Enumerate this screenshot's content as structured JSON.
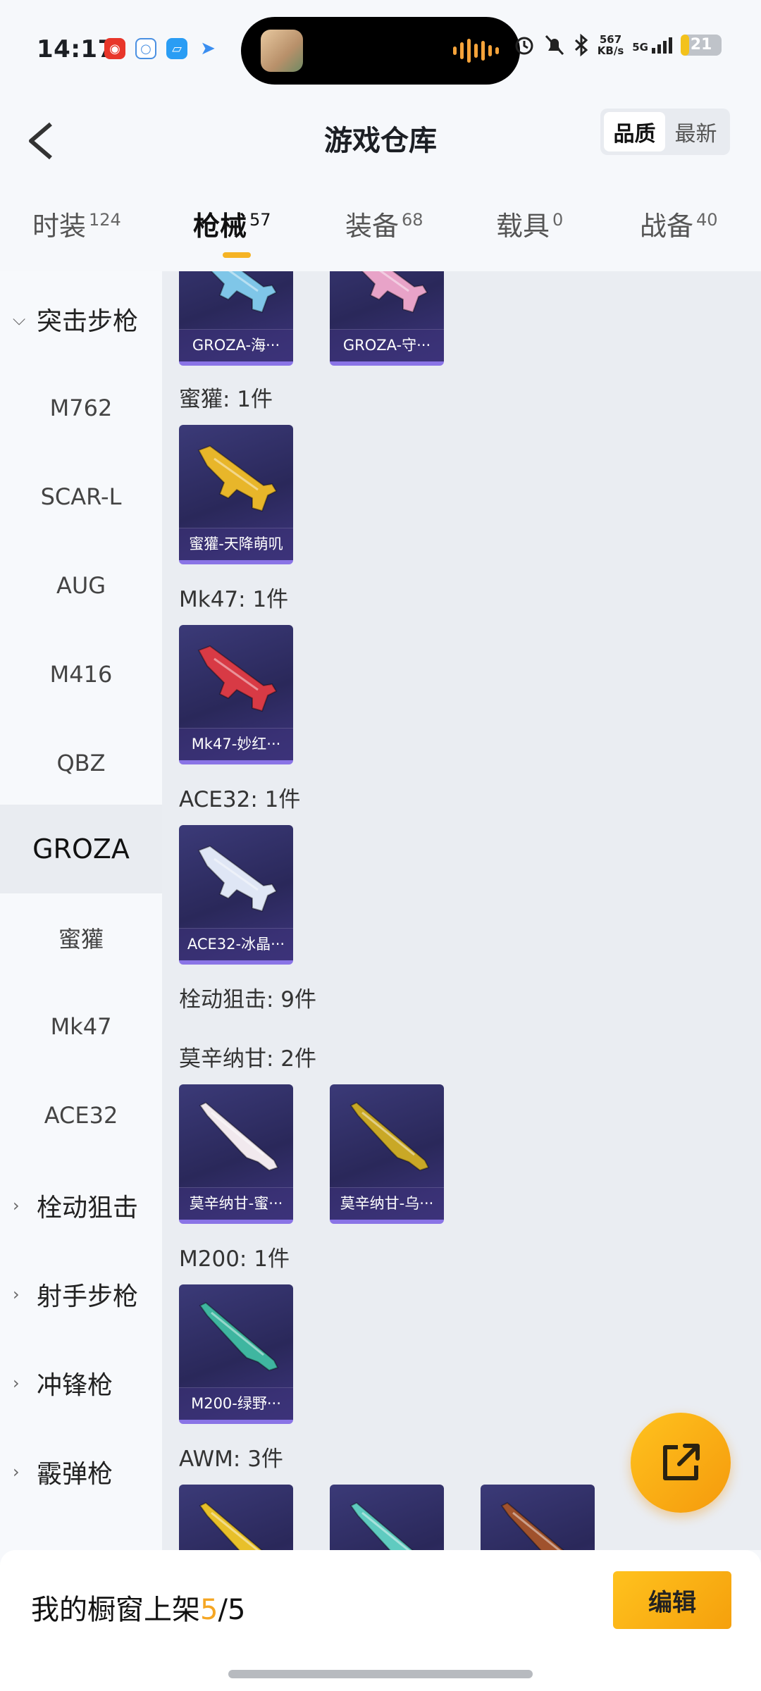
{
  "status_bar": {
    "time": "14:17",
    "net_speed": "567",
    "net_unit": "KB/s",
    "signal": "5G",
    "battery": "21",
    "battery_level": 0.21
  },
  "header": {
    "title": "游戏仓库",
    "sort_options": [
      "品质",
      "最新"
    ],
    "sort_selected": "品质"
  },
  "tabs": [
    {
      "label": "时装",
      "count": "124"
    },
    {
      "label": "枪械",
      "count": "57",
      "active": true
    },
    {
      "label": "装备",
      "count": "68"
    },
    {
      "label": "载具",
      "count": "0"
    },
    {
      "label": "战备",
      "count": "40"
    }
  ],
  "sidebar": {
    "groups": [
      {
        "label": "突击步枪",
        "expanded": true
      },
      {
        "label": "栓动狙击"
      },
      {
        "label": "射手步枪"
      },
      {
        "label": "冲锋枪"
      },
      {
        "label": "霰弹枪"
      }
    ],
    "items": [
      "M762",
      "SCAR-L",
      "AUG",
      "M416",
      "QBZ",
      "GROZA",
      "蜜獾",
      "Mk47",
      "ACE32"
    ],
    "selected": "GROZA"
  },
  "content": {
    "sections": [
      {
        "title": "",
        "items": [
          {
            "name": "GROZA-海···",
            "color": "#7fc6e8"
          },
          {
            "name": "GROZA-守···",
            "color": "#e8a3c8"
          }
        ]
      },
      {
        "title": "蜜獾: 1件",
        "items": [
          {
            "name": "蜜獾-天降萌叽",
            "color": "#e8b62a"
          }
        ]
      },
      {
        "title": "Mk47: 1件",
        "items": [
          {
            "name": "Mk47-妙红···",
            "color": "#d83a45"
          }
        ]
      },
      {
        "title": "ACE32: 1件",
        "items": [
          {
            "name": "ACE32-冰晶···",
            "color": "#dfe6f5"
          }
        ]
      },
      {
        "title": "栓动狙击: 9件",
        "items": []
      },
      {
        "title": "莫辛纳甘: 2件",
        "items": [
          {
            "name": "莫辛纳甘-蜜···",
            "color": "#f1e9ee"
          },
          {
            "name": "莫辛纳甘-乌···",
            "color": "#c9a826"
          }
        ]
      },
      {
        "title": "M200: 1件",
        "items": [
          {
            "name": "M200-绿野···",
            "color": "#3fb6a0"
          }
        ]
      },
      {
        "title": "AWM: 3件",
        "items": [
          {
            "name": "",
            "color": "#e8c02a"
          },
          {
            "name": "",
            "color": "#5fcbc0"
          },
          {
            "name": "",
            "color": "#a0522d"
          }
        ]
      }
    ]
  },
  "bottom_bar": {
    "shelf_label": "我的橱窗上架",
    "shelf_current": "5",
    "shelf_sep": "/",
    "shelf_total": "5",
    "edit_button": "编辑"
  },
  "colors": {
    "accent": "#f5b324",
    "card_bg": "#2f2d66",
    "card_border": "#8a74e6"
  },
  "icons": {
    "back": "chevron-left-icon",
    "fab": "share-external-icon"
  }
}
